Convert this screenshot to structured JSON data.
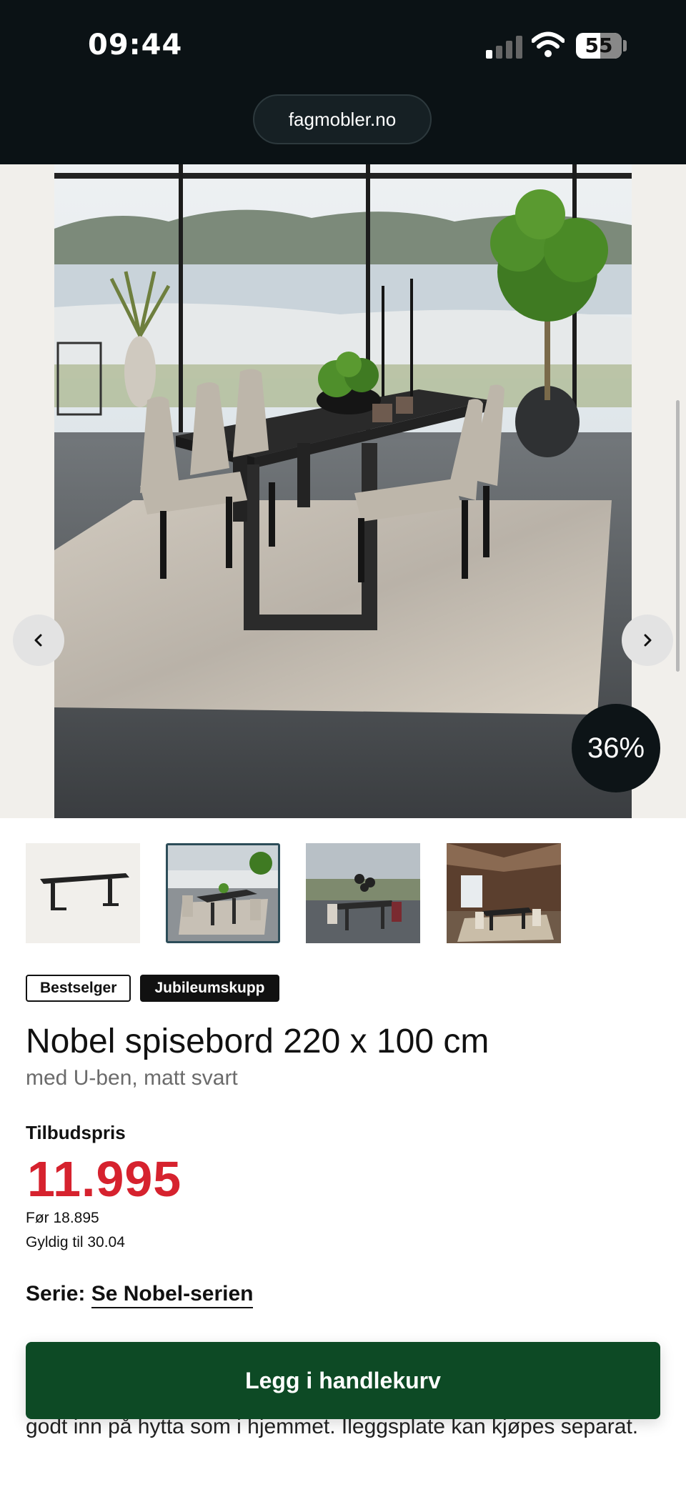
{
  "status_bar": {
    "time": "09:44",
    "battery": "55"
  },
  "browser": {
    "url": "fagmobler.no"
  },
  "gallery": {
    "discount_badge": "36%",
    "thumbnails": [
      "table-only",
      "dining-room-lake",
      "dining-room-pendant",
      "cabin-dining-room"
    ],
    "active_thumbnail": 1
  },
  "product": {
    "badges": [
      "Bestselger",
      "Jubileumskupp"
    ],
    "title": "Nobel spisebord 220 x 100 cm",
    "subtitle": "med U-ben, matt svart",
    "price_label": "Tilbudspris",
    "price": "11.995",
    "before_price": "Før 18.895",
    "valid_until": "Gyldig til 30.04",
    "series_label": "Serie:",
    "series_link": "Se Nobel-serien",
    "description_line": "godt inn på hytta som i hjemmet. Ileggsplate kan kjøpes separat."
  },
  "actions": {
    "add_to_cart": "Legg i handlekurv"
  },
  "colors": {
    "price_red": "#d6222e",
    "cart_green": "#0d4a25",
    "status_bg": "#0b1215"
  }
}
